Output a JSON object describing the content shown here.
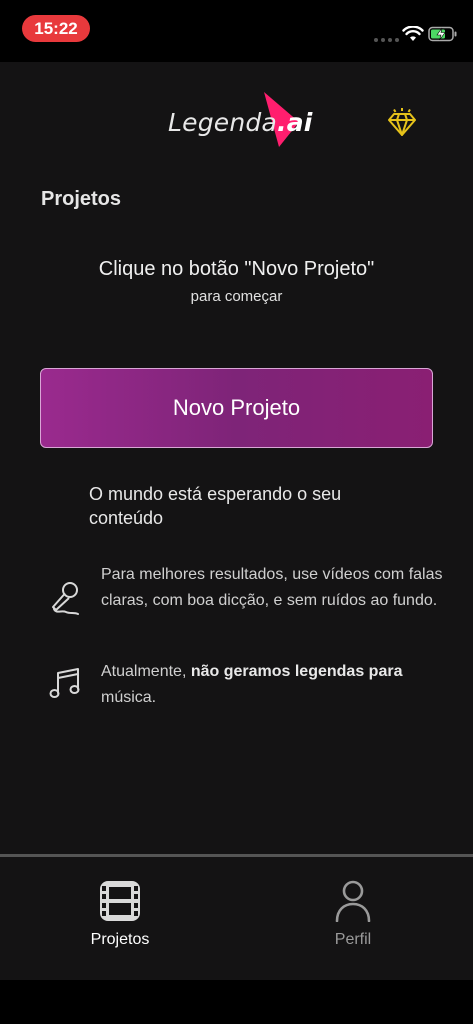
{
  "status_bar": {
    "time": "15:22"
  },
  "header": {
    "logo_text": "Legenda",
    "logo_suffix": ".ai"
  },
  "main": {
    "section_title": "Projetos",
    "empty_hint": "Clique no botão \"Novo Projeto\"",
    "empty_hint_sub": "para começar",
    "new_project_label": "Novo Projeto",
    "waiting_text": "O mundo está esperando o seu conteúdo",
    "tips": [
      {
        "icon": "microphone-icon",
        "text": "Para melhores resultados, use vídeos com falas claras, com boa dicção, e sem ruídos ao fundo."
      },
      {
        "icon": "music-note-icon",
        "text_prefix": "Atualmente, ",
        "text_bold": "não geramos legendas para",
        "text_suffix": " música."
      }
    ]
  },
  "tabbar": {
    "tabs": [
      {
        "label": "Projetos",
        "icon": "film-icon",
        "active": true
      },
      {
        "label": "Perfil",
        "icon": "person-icon",
        "active": false
      }
    ]
  },
  "colors": {
    "accent": "#ff1e6e",
    "button": "#8a2580",
    "background": "#141314",
    "diamond": "#e6c21a"
  }
}
